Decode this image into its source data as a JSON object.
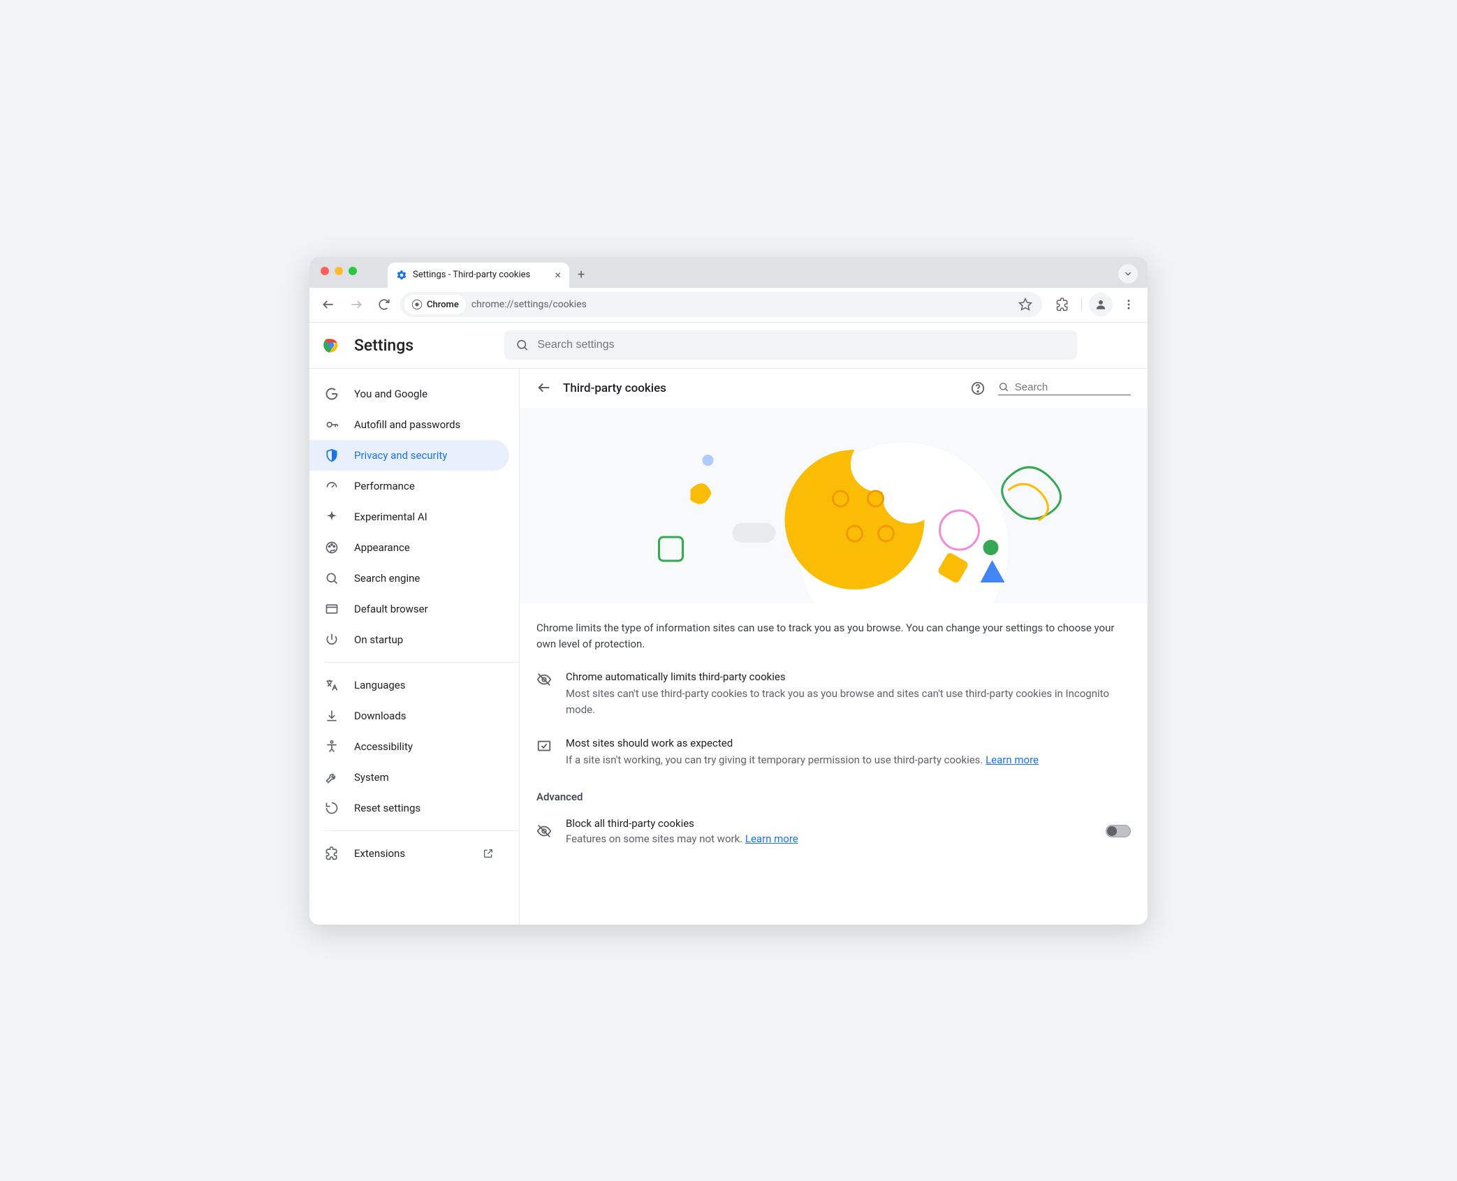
{
  "browser": {
    "tab_title": "Settings - Third-party cookies",
    "chip_label": "Chrome",
    "url": "chrome://settings/cookies"
  },
  "header": {
    "title": "Settings",
    "search_placeholder": "Search settings"
  },
  "sidebar": {
    "items": [
      {
        "label": "You and Google"
      },
      {
        "label": "Autofill and passwords"
      },
      {
        "label": "Privacy and security"
      },
      {
        "label": "Performance"
      },
      {
        "label": "Experimental AI"
      },
      {
        "label": "Appearance"
      },
      {
        "label": "Search engine"
      },
      {
        "label": "Default browser"
      },
      {
        "label": "On startup"
      }
    ],
    "items2": [
      {
        "label": "Languages"
      },
      {
        "label": "Downloads"
      },
      {
        "label": "Accessibility"
      },
      {
        "label": "System"
      },
      {
        "label": "Reset settings"
      }
    ],
    "extensions_label": "Extensions"
  },
  "main": {
    "subheader_title": "Third-party cookies",
    "sub_search_placeholder": "Search",
    "intro": "Chrome limits the type of information sites can use to track you as you browse. You can change your settings to choose your own level of protection.",
    "info1_title": "Chrome automatically limits third-party cookies",
    "info1_desc": "Most sites can't use third-party cookies to track you as you browse and sites can't use third-party cookies in Incognito mode.",
    "info2_title": "Most sites should work as expected",
    "info2_desc": "If a site isn't working, you can try giving it temporary permission to use third-party cookies. ",
    "info2_link": "Learn more",
    "advanced_label": "Advanced",
    "toggle_title": "Block all third-party cookies",
    "toggle_desc": "Features on some sites may not work. ",
    "toggle_link": "Learn more"
  }
}
